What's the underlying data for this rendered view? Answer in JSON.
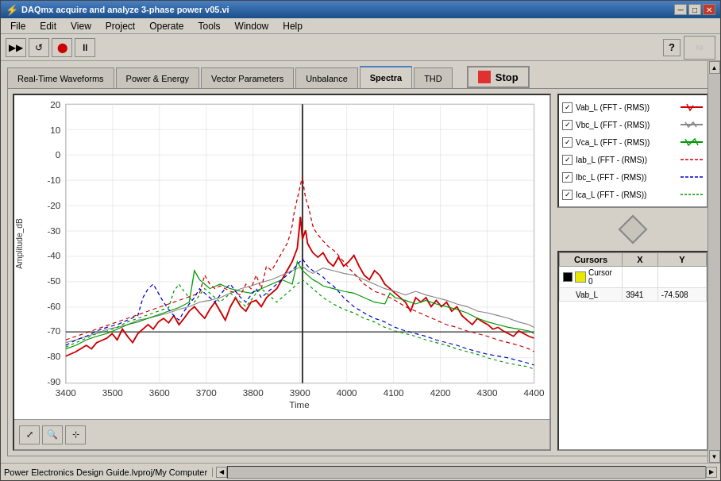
{
  "titleBar": {
    "title": "DAQmx acquire and analyze 3-phase power v05.vi",
    "minBtn": "─",
    "maxBtn": "□",
    "closeBtn": "✕"
  },
  "menu": {
    "items": [
      "File",
      "Edit",
      "View",
      "Project",
      "Operate",
      "Tools",
      "Window",
      "Help"
    ]
  },
  "tabs": {
    "items": [
      "Real-Time Waveforms",
      "Power & Energy",
      "Vector Parameters",
      "Unbalance",
      "Spectra",
      "THD"
    ],
    "active": 4
  },
  "stopButton": {
    "label": "Stop"
  },
  "chart": {
    "yAxisLabel": "Amplitude_dB",
    "xAxisLabel": "Time",
    "yMin": -90,
    "yMax": 20,
    "xMin": 3400,
    "xMax": 4400,
    "yTicks": [
      20,
      10,
      0,
      -10,
      -20,
      -30,
      -40,
      -50,
      -60,
      -70,
      -80,
      -90
    ],
    "xTicks": [
      3400,
      3500,
      3600,
      3700,
      3800,
      3900,
      4000,
      4100,
      4200,
      4300,
      4400
    ]
  },
  "legend": {
    "items": [
      {
        "label": "Vab_L (FFT - (RMS))",
        "color": "#cc0000",
        "style": "solid",
        "checked": true
      },
      {
        "label": "Vbc_L (FFT - (RMS))",
        "color": "#888888",
        "style": "solid",
        "checked": true
      },
      {
        "label": "Vca_L (FFT - (RMS))",
        "color": "#009900",
        "style": "solid",
        "checked": true
      },
      {
        "label": "Iab_L (FFT - (RMS))",
        "color": "#cc0000",
        "style": "dashed",
        "checked": true
      },
      {
        "label": "Ibc_L (FFT - (RMS))",
        "color": "#0000cc",
        "style": "dashed",
        "checked": true
      },
      {
        "label": "Ica_L (FFT - (RMS))",
        "color": "#009900",
        "style": "dashed",
        "checked": true
      }
    ]
  },
  "cursors": {
    "header": "Cursors",
    "colX": "X",
    "colY": "Y",
    "rows": [
      {
        "name": "Cursor 0",
        "x": "",
        "y": ""
      },
      {
        "name": "Vab_L",
        "x": "3941",
        "y": "-74.508"
      }
    ]
  },
  "statusBar": {
    "path": "Power Electronics Design Guide.lvproj/My Computer"
  }
}
